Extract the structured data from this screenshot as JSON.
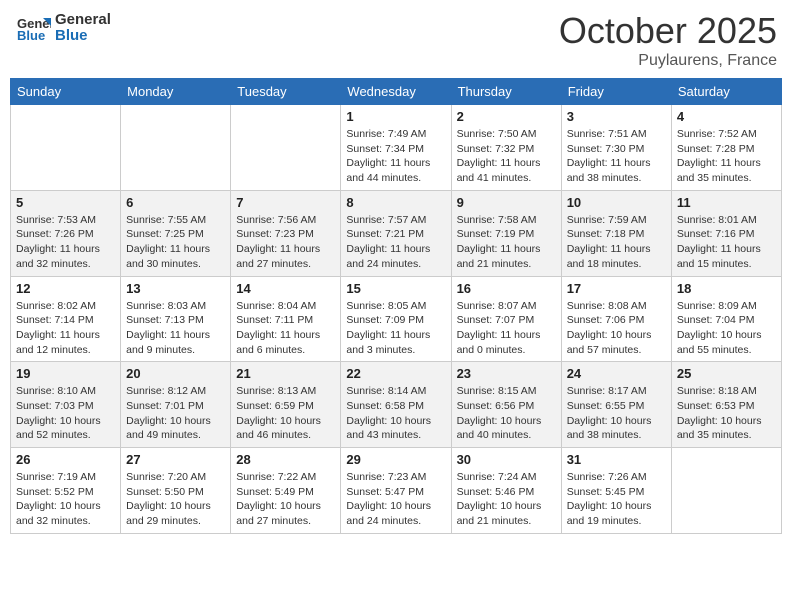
{
  "header": {
    "logo_general": "General",
    "logo_blue": "Blue",
    "month": "October 2025",
    "location": "Puylaurens, France"
  },
  "weekdays": [
    "Sunday",
    "Monday",
    "Tuesday",
    "Wednesday",
    "Thursday",
    "Friday",
    "Saturday"
  ],
  "weeks": [
    [
      {
        "day": "",
        "sunrise": "",
        "sunset": "",
        "daylight": ""
      },
      {
        "day": "",
        "sunrise": "",
        "sunset": "",
        "daylight": ""
      },
      {
        "day": "",
        "sunrise": "",
        "sunset": "",
        "daylight": ""
      },
      {
        "day": "1",
        "sunrise": "Sunrise: 7:49 AM",
        "sunset": "Sunset: 7:34 PM",
        "daylight": "Daylight: 11 hours and 44 minutes."
      },
      {
        "day": "2",
        "sunrise": "Sunrise: 7:50 AM",
        "sunset": "Sunset: 7:32 PM",
        "daylight": "Daylight: 11 hours and 41 minutes."
      },
      {
        "day": "3",
        "sunrise": "Sunrise: 7:51 AM",
        "sunset": "Sunset: 7:30 PM",
        "daylight": "Daylight: 11 hours and 38 minutes."
      },
      {
        "day": "4",
        "sunrise": "Sunrise: 7:52 AM",
        "sunset": "Sunset: 7:28 PM",
        "daylight": "Daylight: 11 hours and 35 minutes."
      }
    ],
    [
      {
        "day": "5",
        "sunrise": "Sunrise: 7:53 AM",
        "sunset": "Sunset: 7:26 PM",
        "daylight": "Daylight: 11 hours and 32 minutes."
      },
      {
        "day": "6",
        "sunrise": "Sunrise: 7:55 AM",
        "sunset": "Sunset: 7:25 PM",
        "daylight": "Daylight: 11 hours and 30 minutes."
      },
      {
        "day": "7",
        "sunrise": "Sunrise: 7:56 AM",
        "sunset": "Sunset: 7:23 PM",
        "daylight": "Daylight: 11 hours and 27 minutes."
      },
      {
        "day": "8",
        "sunrise": "Sunrise: 7:57 AM",
        "sunset": "Sunset: 7:21 PM",
        "daylight": "Daylight: 11 hours and 24 minutes."
      },
      {
        "day": "9",
        "sunrise": "Sunrise: 7:58 AM",
        "sunset": "Sunset: 7:19 PM",
        "daylight": "Daylight: 11 hours and 21 minutes."
      },
      {
        "day": "10",
        "sunrise": "Sunrise: 7:59 AM",
        "sunset": "Sunset: 7:18 PM",
        "daylight": "Daylight: 11 hours and 18 minutes."
      },
      {
        "day": "11",
        "sunrise": "Sunrise: 8:01 AM",
        "sunset": "Sunset: 7:16 PM",
        "daylight": "Daylight: 11 hours and 15 minutes."
      }
    ],
    [
      {
        "day": "12",
        "sunrise": "Sunrise: 8:02 AM",
        "sunset": "Sunset: 7:14 PM",
        "daylight": "Daylight: 11 hours and 12 minutes."
      },
      {
        "day": "13",
        "sunrise": "Sunrise: 8:03 AM",
        "sunset": "Sunset: 7:13 PM",
        "daylight": "Daylight: 11 hours and 9 minutes."
      },
      {
        "day": "14",
        "sunrise": "Sunrise: 8:04 AM",
        "sunset": "Sunset: 7:11 PM",
        "daylight": "Daylight: 11 hours and 6 minutes."
      },
      {
        "day": "15",
        "sunrise": "Sunrise: 8:05 AM",
        "sunset": "Sunset: 7:09 PM",
        "daylight": "Daylight: 11 hours and 3 minutes."
      },
      {
        "day": "16",
        "sunrise": "Sunrise: 8:07 AM",
        "sunset": "Sunset: 7:07 PM",
        "daylight": "Daylight: 11 hours and 0 minutes."
      },
      {
        "day": "17",
        "sunrise": "Sunrise: 8:08 AM",
        "sunset": "Sunset: 7:06 PM",
        "daylight": "Daylight: 10 hours and 57 minutes."
      },
      {
        "day": "18",
        "sunrise": "Sunrise: 8:09 AM",
        "sunset": "Sunset: 7:04 PM",
        "daylight": "Daylight: 10 hours and 55 minutes."
      }
    ],
    [
      {
        "day": "19",
        "sunrise": "Sunrise: 8:10 AM",
        "sunset": "Sunset: 7:03 PM",
        "daylight": "Daylight: 10 hours and 52 minutes."
      },
      {
        "day": "20",
        "sunrise": "Sunrise: 8:12 AM",
        "sunset": "Sunset: 7:01 PM",
        "daylight": "Daylight: 10 hours and 49 minutes."
      },
      {
        "day": "21",
        "sunrise": "Sunrise: 8:13 AM",
        "sunset": "Sunset: 6:59 PM",
        "daylight": "Daylight: 10 hours and 46 minutes."
      },
      {
        "day": "22",
        "sunrise": "Sunrise: 8:14 AM",
        "sunset": "Sunset: 6:58 PM",
        "daylight": "Daylight: 10 hours and 43 minutes."
      },
      {
        "day": "23",
        "sunrise": "Sunrise: 8:15 AM",
        "sunset": "Sunset: 6:56 PM",
        "daylight": "Daylight: 10 hours and 40 minutes."
      },
      {
        "day": "24",
        "sunrise": "Sunrise: 8:17 AM",
        "sunset": "Sunset: 6:55 PM",
        "daylight": "Daylight: 10 hours and 38 minutes."
      },
      {
        "day": "25",
        "sunrise": "Sunrise: 8:18 AM",
        "sunset": "Sunset: 6:53 PM",
        "daylight": "Daylight: 10 hours and 35 minutes."
      }
    ],
    [
      {
        "day": "26",
        "sunrise": "Sunrise: 7:19 AM",
        "sunset": "Sunset: 5:52 PM",
        "daylight": "Daylight: 10 hours and 32 minutes."
      },
      {
        "day": "27",
        "sunrise": "Sunrise: 7:20 AM",
        "sunset": "Sunset: 5:50 PM",
        "daylight": "Daylight: 10 hours and 29 minutes."
      },
      {
        "day": "28",
        "sunrise": "Sunrise: 7:22 AM",
        "sunset": "Sunset: 5:49 PM",
        "daylight": "Daylight: 10 hours and 27 minutes."
      },
      {
        "day": "29",
        "sunrise": "Sunrise: 7:23 AM",
        "sunset": "Sunset: 5:47 PM",
        "daylight": "Daylight: 10 hours and 24 minutes."
      },
      {
        "day": "30",
        "sunrise": "Sunrise: 7:24 AM",
        "sunset": "Sunset: 5:46 PM",
        "daylight": "Daylight: 10 hours and 21 minutes."
      },
      {
        "day": "31",
        "sunrise": "Sunrise: 7:26 AM",
        "sunset": "Sunset: 5:45 PM",
        "daylight": "Daylight: 10 hours and 19 minutes."
      },
      {
        "day": "",
        "sunrise": "",
        "sunset": "",
        "daylight": ""
      }
    ]
  ]
}
